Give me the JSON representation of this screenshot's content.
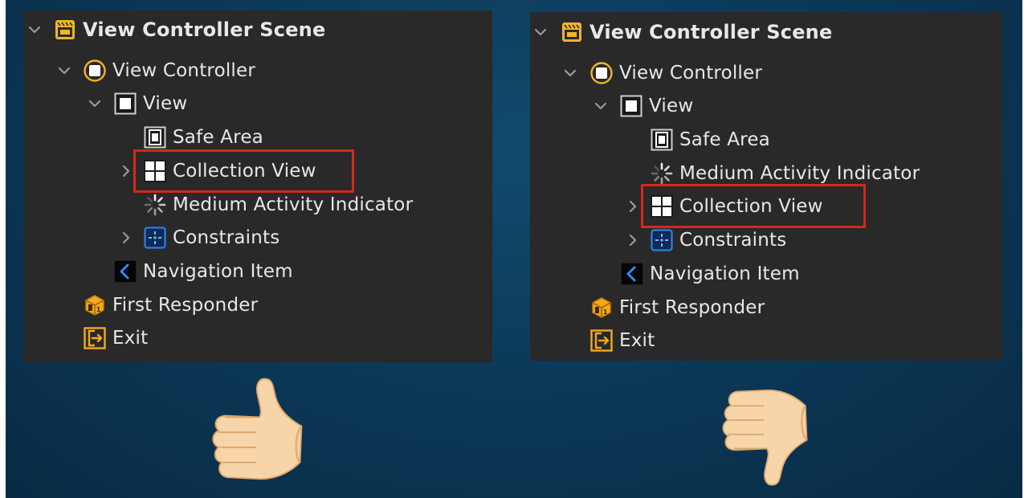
{
  "colors": {
    "background": "#0c3a59",
    "panel": "#292929",
    "text": "#e8e8e8",
    "highlight": "#d6281c",
    "accent_yellow": "#f4b428",
    "accent_blue": "#2f7fe0"
  },
  "left_panel": {
    "scene_title": "View Controller Scene",
    "view_controller": "View Controller",
    "view": "View",
    "safe_area": "Safe Area",
    "collection_view": "Collection View",
    "activity_indicator": "Medium Activity Indicator",
    "constraints": "Constraints",
    "navigation_item": "Navigation Item",
    "first_responder": "First Responder",
    "exit": "Exit",
    "verdict_icon": "thumbs-up-icon"
  },
  "right_panel": {
    "scene_title": "View Controller Scene",
    "view_controller": "View Controller",
    "view": "View",
    "safe_area": "Safe Area",
    "activity_indicator": "Medium Activity Indicator",
    "collection_view": "Collection View",
    "constraints": "Constraints",
    "navigation_item": "Navigation Item",
    "first_responder": "First Responder",
    "exit": "Exit",
    "verdict_icon": "thumbs-down-icon"
  }
}
